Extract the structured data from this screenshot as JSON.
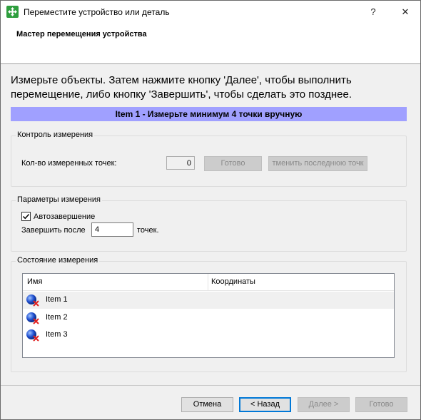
{
  "window": {
    "title": "Переместите устройство или деталь",
    "help_glyph": "?",
    "close_glyph": "✕"
  },
  "wizard": {
    "title": "Мастер перемещения устройства",
    "instruction_line1": "Измерьте объекты. Затем нажмите кнопку 'Далее', чтобы выполнить",
    "instruction_line2": "перемещение, либо кнопку 'Завершить', чтобы сделать это позднее.",
    "banner": "Item 1 - Измерьте минимум 4 точки вручную"
  },
  "control_group": {
    "label": "Контроль измерения",
    "points_label": "Кол-во измеренных точек:",
    "points_value": "0",
    "done_button": "Готово",
    "undo_button": "тменить последнюю точк"
  },
  "params_group": {
    "label": "Параметры измерения",
    "autocomplete_label": "Автозавершение",
    "autocomplete_checked": true,
    "finish_after_label": "Завершить после",
    "finish_after_value": "4",
    "points_unit": "точек."
  },
  "status_group": {
    "label": "Состояние измерения",
    "columns": [
      "Имя",
      "Координаты"
    ],
    "rows": [
      {
        "name": "Item 1",
        "icon": "sphere-error-icon"
      },
      {
        "name": "Item 2",
        "icon": "sphere-error-icon"
      },
      {
        "name": "Item 3",
        "icon": "sphere-error-icon"
      }
    ]
  },
  "footer": {
    "cancel": "Отмена",
    "back": "< Назад",
    "next": "Далее >",
    "finish": "Готово"
  },
  "colors": {
    "banner": "#a0a0ff",
    "accent": "#0078d7",
    "error_x": "#e02020",
    "sphere": "#1f4fd0"
  }
}
